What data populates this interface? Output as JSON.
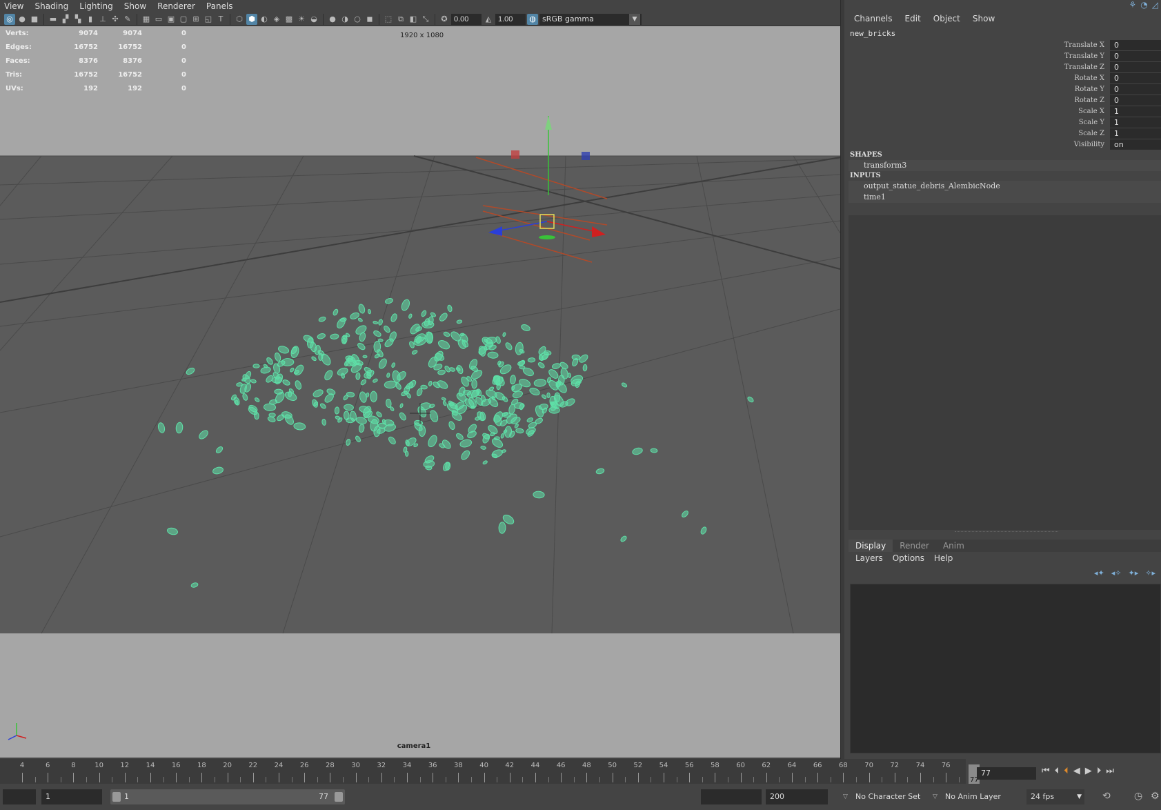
{
  "viewport_menu": [
    "View",
    "Shading",
    "Lighting",
    "Show",
    "Renderer",
    "Panels"
  ],
  "toolbar": {
    "exposure": "0.00",
    "gamma": "1.00",
    "color_space": "sRGB gamma"
  },
  "hud": {
    "rows": [
      {
        "label": "Verts:",
        "a": "9074",
        "b": "9074",
        "c": "0"
      },
      {
        "label": "Edges:",
        "a": "16752",
        "b": "16752",
        "c": "0"
      },
      {
        "label": "Faces:",
        "a": "8376",
        "b": "8376",
        "c": "0"
      },
      {
        "label": "Tris:",
        "a": "16752",
        "b": "16752",
        "c": "0"
      },
      {
        "label": "UVs:",
        "a": "192",
        "b": "192",
        "c": "0"
      }
    ],
    "resolution": "1920 x 1080",
    "camera": "camera1"
  },
  "channel_box": {
    "menu": [
      "Channels",
      "Edit",
      "Object",
      "Show"
    ],
    "node": "new_bricks",
    "attributes": [
      {
        "name": "Translate X",
        "value": "0"
      },
      {
        "name": "Translate Y",
        "value": "0"
      },
      {
        "name": "Translate Z",
        "value": "0"
      },
      {
        "name": "Rotate X",
        "value": "0"
      },
      {
        "name": "Rotate Y",
        "value": "0"
      },
      {
        "name": "Rotate Z",
        "value": "0"
      },
      {
        "name": "Scale X",
        "value": "1"
      },
      {
        "name": "Scale Y",
        "value": "1"
      },
      {
        "name": "Scale Z",
        "value": "1"
      },
      {
        "name": "Visibility",
        "value": "on"
      }
    ],
    "shapes_header": "SHAPES",
    "shapes": [
      "transform3"
    ],
    "inputs_header": "INPUTS",
    "inputs": [
      "output_statue_debris_AlembicNode",
      "time1"
    ]
  },
  "layer_editor": {
    "tabs": [
      "Display",
      "Render",
      "Anim"
    ],
    "menu": [
      "Layers",
      "Options",
      "Help"
    ]
  },
  "timeline": {
    "ticks": [
      "4",
      "6",
      "8",
      "10",
      "12",
      "14",
      "16",
      "18",
      "20",
      "22",
      "24",
      "26",
      "28",
      "30",
      "32",
      "34",
      "36",
      "38",
      "40",
      "42",
      "44",
      "46",
      "48",
      "50",
      "52",
      "54",
      "56",
      "58",
      "60",
      "62",
      "64",
      "66",
      "68",
      "70",
      "72",
      "74",
      "76"
    ],
    "playhead": "77",
    "current_frame": "77"
  },
  "range": {
    "start": "1",
    "slider_start": "1",
    "slider_end": "77",
    "end": "200",
    "character_set": "No Character Set",
    "anim_layer": "No Anim Layer",
    "fps": "24 fps"
  },
  "colors": {
    "debris": "#5fe0a8",
    "accent": "#5285a6",
    "ground": "#5a5a5a",
    "background": "#a6a6a6"
  }
}
